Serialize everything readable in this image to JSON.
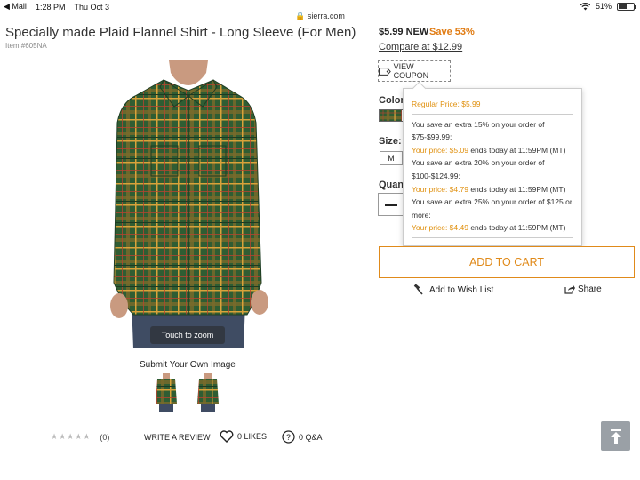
{
  "status_bar": {
    "back_app": "Mail",
    "time": "1:28 PM",
    "date": "Thu Oct 3",
    "url": "sierra.com",
    "battery": "51%",
    "battery_level": 0.51
  },
  "product": {
    "title": "Specially made Plaid Flannel Shirt - Long Sleeve (For Men)",
    "item_no": "Item #605NA",
    "image_overlay": "Touch to zoom",
    "submit_image": "Submit Your Own Image"
  },
  "reviews": {
    "star_count": 5,
    "rating_count": "(0)",
    "write_review": "WRITE A REVIEW",
    "likes": "0 LIKES",
    "qa": "0 Q&A"
  },
  "pricing": {
    "price": "$5.99 NEW",
    "save": "Save 53%",
    "compare": "Compare at $12.99",
    "coupon_label": "VIEW COUPON"
  },
  "options": {
    "colors_label": "Colors",
    "size_label": "Size:",
    "size_value": "M",
    "quantity_label": "Quant"
  },
  "coupon_popover": {
    "regular": "Regular Price: $5.99",
    "tiers": [
      {
        "desc": "You save an extra 15% on your order of $75-$99.99:",
        "your_price": "Your price: $5.09",
        "ends": " ends today at 11:59PM (MT)"
      },
      {
        "desc": "You save an extra 20% on your order of $100-$124.99:",
        "your_price": "Your price: $4.79",
        "ends": " ends today at 11:59PM (MT)"
      },
      {
        "desc": "You save an extra 25% on your order of $125 or more:",
        "your_price": "Your price: $4.49",
        "ends": " ends today at 11:59PM (MT)"
      }
    ]
  },
  "actions": {
    "add_to_cart": "ADD TO CART",
    "wish_list": "Add to Wish List",
    "share": "Share"
  },
  "colors": {
    "accent": "#e08a1a",
    "shirt_green": "#2e5a2e",
    "fab": "#9aa0a6"
  },
  "icons": {
    "coupon": "tag-icon",
    "wish": "hammer-icon",
    "share": "share-icon",
    "likes": "heart-icon",
    "qa": "question-icon",
    "fab": "scroll-top-icon"
  }
}
